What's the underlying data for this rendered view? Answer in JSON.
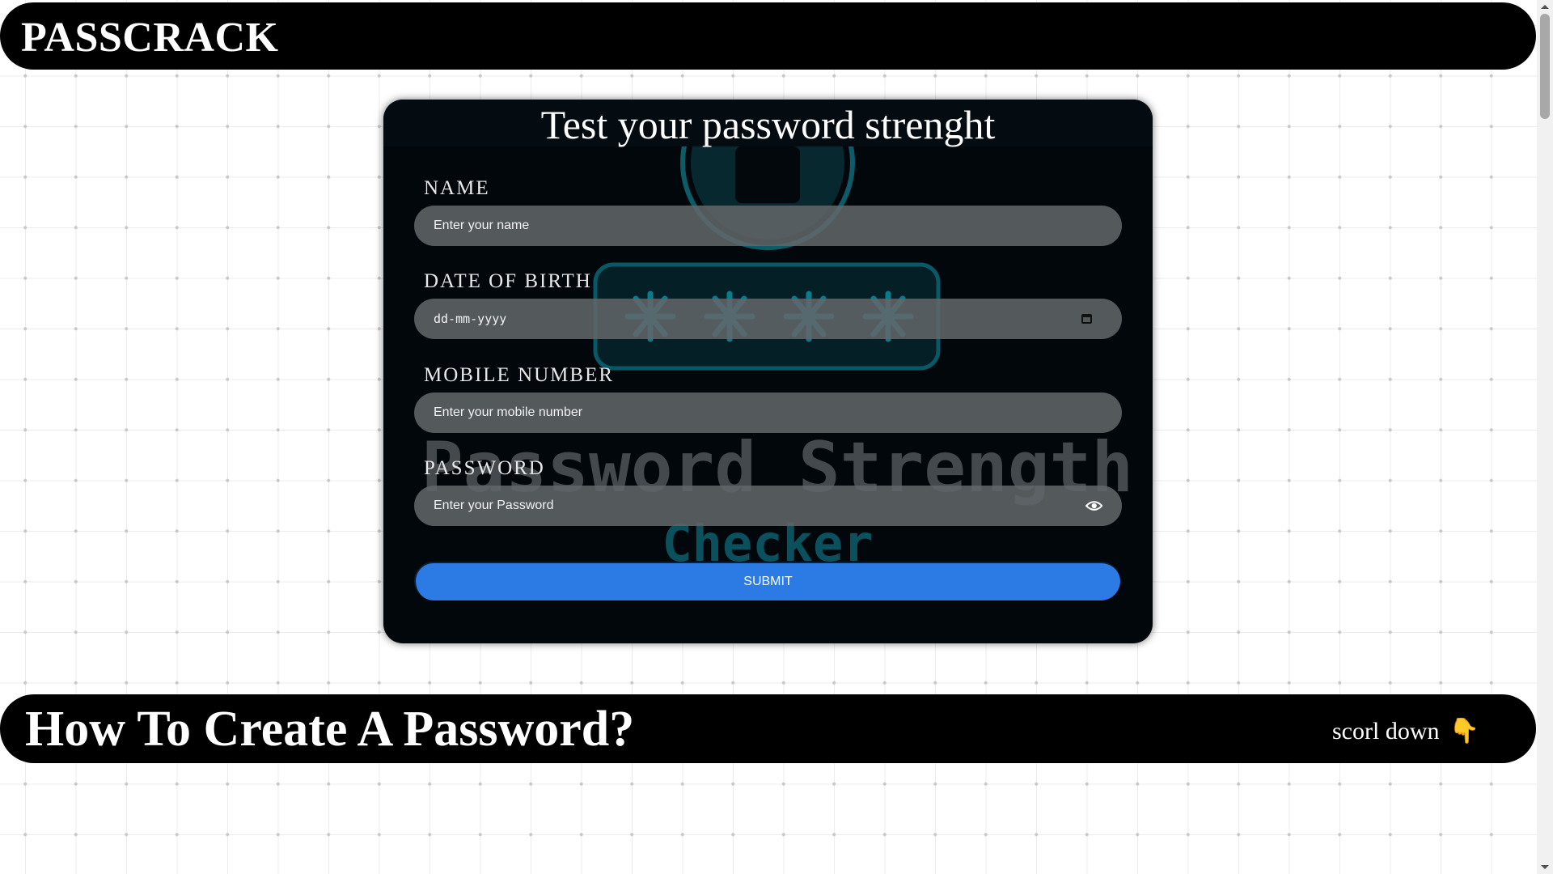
{
  "header": {
    "brand": "PASSCRACK"
  },
  "card": {
    "title": "Test your password strenght",
    "art_text_line1": "Password Strength",
    "art_text_line2": "Checker",
    "fields": {
      "name": {
        "label": "NAME",
        "placeholder": "Enter your name"
      },
      "dob": {
        "label": "DATE OF BIRTH",
        "value": "dd-mm-yyyy",
        "icon": "calendar-icon"
      },
      "mobile": {
        "label": "MOBILE NUMBER",
        "placeholder": "Enter your mobile number"
      },
      "password": {
        "label": "PASSWORD",
        "placeholder": "Enter your Password",
        "icon": "eye-icon"
      }
    },
    "submit_label": "SUBMIT"
  },
  "section": {
    "title": "How To Create A Password?",
    "scroll_hint": "scorl down",
    "scroll_hint_icon": "👇"
  },
  "colors": {
    "page_bg": "#ffffff",
    "banner_bg": "#000000",
    "card_bg": "#02070c",
    "field_bg": "#62666a",
    "accent": "#2c7ae3",
    "art_cyan": "#0fb3c9"
  }
}
